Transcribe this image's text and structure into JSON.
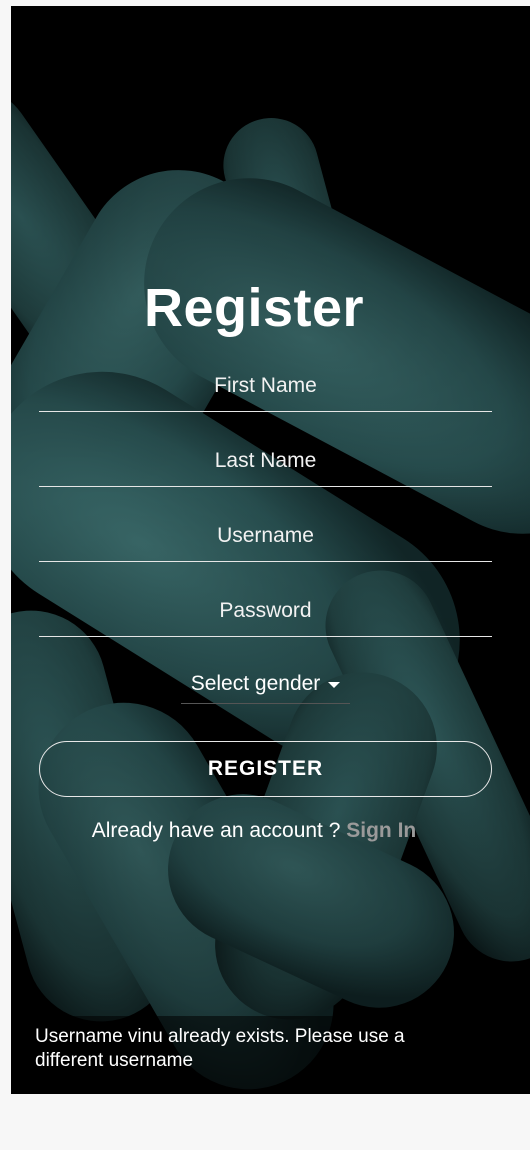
{
  "title": "Register",
  "fields": {
    "first_name": {
      "placeholder": "First Name",
      "value": ""
    },
    "last_name": {
      "placeholder": "Last Name",
      "value": ""
    },
    "username": {
      "placeholder": "Username",
      "value": ""
    },
    "password": {
      "placeholder": "Password",
      "value": ""
    }
  },
  "gender_select": {
    "label": "Select gender",
    "icon": "caret-down-icon"
  },
  "register_button": {
    "label": "REGISTER"
  },
  "signin_prompt": {
    "text": "Already have an account ? ",
    "link": "Sign In"
  },
  "toast": {
    "message": "Username vinu already exists. Please use a different username"
  },
  "colors": {
    "background": "#000000",
    "bacteria": "#2e5a5a",
    "text": "#ffffff",
    "link": "#9a9a9a"
  }
}
